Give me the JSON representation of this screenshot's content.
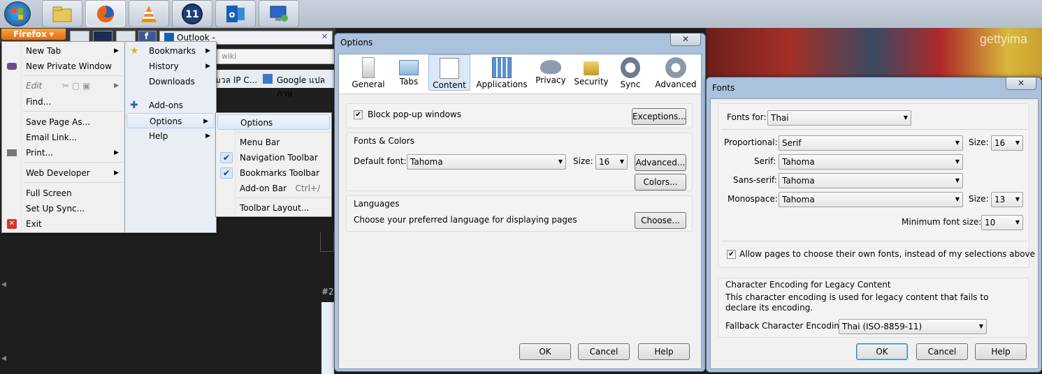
{
  "taskbar": {
    "apps": [
      "start-orb",
      "file-explorer",
      "firefox",
      "vlc",
      "clock-app",
      "outlook",
      "remote-desktop"
    ]
  },
  "firefox": {
    "button_label": "Firefox ▾",
    "tab_outlook": "Outlook -",
    "address_fragment": "wiki",
    "bookmarks": [
      "มวล IP C...",
      "Google แปลภาษ"
    ],
    "tab_number": "#2"
  },
  "main_menu": {
    "items": [
      {
        "label": "New Tab"
      },
      {
        "label": "New Private Window"
      },
      {
        "label": "Edit"
      },
      {
        "label": "Find..."
      },
      {
        "label": "Save Page As..."
      },
      {
        "label": "Email Link..."
      },
      {
        "label": "Print..."
      },
      {
        "label": "Web Developer"
      },
      {
        "label": "Full Screen"
      },
      {
        "label": "Set Up Sync..."
      },
      {
        "label": "Exit"
      }
    ]
  },
  "right_menu": {
    "items": [
      {
        "label": "Bookmarks"
      },
      {
        "label": "History"
      },
      {
        "label": "Downloads"
      },
      {
        "label": "Add-ons"
      },
      {
        "label": "Options"
      },
      {
        "label": "Help"
      }
    ]
  },
  "options_submenu": {
    "items": [
      {
        "label": "Options"
      },
      {
        "label": "Menu Bar"
      },
      {
        "label": "Navigation Toolbar"
      },
      {
        "label": "Bookmarks Toolbar"
      },
      {
        "label": "Add-on Bar",
        "shortcut": "Ctrl+/"
      },
      {
        "label": "Toolbar Layout..."
      }
    ]
  },
  "options_dialog": {
    "title": "Options",
    "tabs": [
      "General",
      "Tabs",
      "Content",
      "Applications",
      "Privacy",
      "Security",
      "Sync",
      "Advanced"
    ],
    "selected_tab": "Content",
    "block_popups_label": "Block pop-up windows",
    "exceptions_label": "Exceptions...",
    "fonts_colors_title": "Fonts & Colors",
    "default_font_label": "Default font:",
    "default_font_value": "Tahoma",
    "size_label": "Size:",
    "size_value": "16",
    "advanced_label": "Advanced...",
    "colors_label": "Colors...",
    "languages_title": "Languages",
    "languages_text": "Choose your preferred language for displaying pages",
    "choose_label": "Choose...",
    "ok_label": "OK",
    "cancel_label": "Cancel",
    "help_label": "Help"
  },
  "fonts_dialog": {
    "title": "Fonts",
    "fonts_for_label": "Fonts for:",
    "fonts_for_value": "Thai",
    "proportional_label": "Proportional:",
    "proportional_value": "Serif",
    "size_label": "Size:",
    "proportional_size": "16",
    "serif_label": "Serif:",
    "serif_value": "Tahoma",
    "sans_label": "Sans-serif:",
    "sans_value": "Tahoma",
    "mono_label": "Monospace:",
    "mono_value": "Tahoma",
    "mono_size": "13",
    "min_size_label": "Minimum font size:",
    "min_size_value": "10",
    "allow_label": "Allow pages to choose their own fonts, instead of my selections above",
    "encoding_title": "Character Encoding for Legacy Content",
    "encoding_text": "This character encoding is used for legacy content that fails to declare its encoding.",
    "fallback_label": "Fallback Character Encoding:",
    "fallback_value": "Thai (ISO-8859-11)",
    "ok_label": "OK",
    "cancel_label": "Cancel",
    "help_label": "Help",
    "watermark": "gettyima"
  }
}
